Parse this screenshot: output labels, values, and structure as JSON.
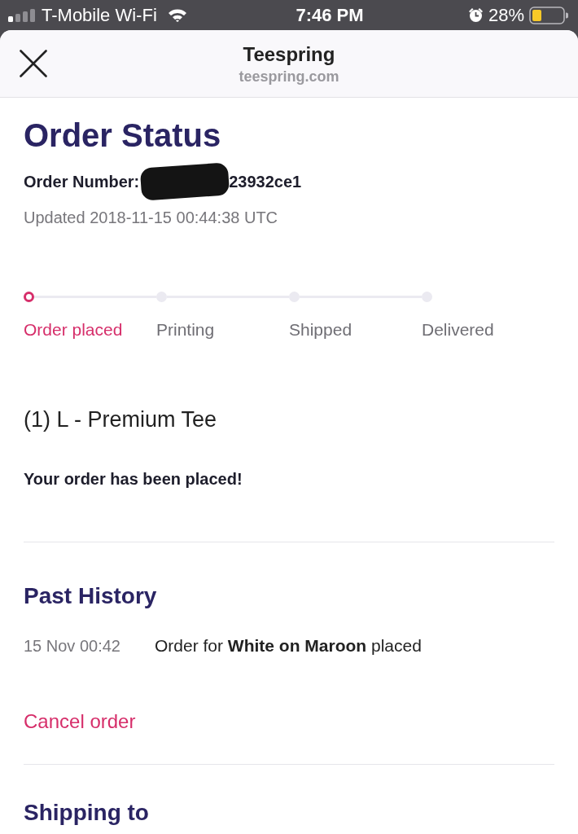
{
  "status_bar": {
    "carrier": "T-Mobile Wi-Fi",
    "time": "7:46 PM",
    "battery": "28%"
  },
  "header": {
    "title": "Teespring",
    "url": "teespring.com"
  },
  "order": {
    "title": "Order Status",
    "number_label": "Order Number:",
    "number": "23932ce1",
    "updated": "Updated 2018-11-15 00:44:38 UTC"
  },
  "steps": [
    {
      "label": "Order placed",
      "selected": true
    },
    {
      "label": "Printing",
      "selected": false
    },
    {
      "label": "Shipped",
      "selected": false
    },
    {
      "label": "Delivered",
      "selected": false
    }
  ],
  "item": {
    "title": "(1) L - Premium Tee",
    "message": "Your order has been placed!"
  },
  "history": {
    "title": "Past History",
    "entries": [
      {
        "time": "15 Nov 00:42",
        "text": "Order for **White on Maroon** placed"
      }
    ]
  },
  "cancel": "Cancel order",
  "shipping": {
    "title": "Shipping to"
  }
}
